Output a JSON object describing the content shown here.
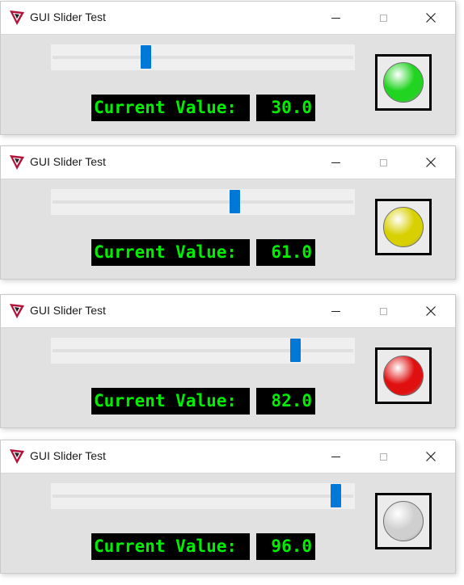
{
  "colors": {
    "lcd_text": "#00ee00",
    "lcd_background": "#000000",
    "slider_thumb": "#0078d7",
    "lamp_green": "#22d422",
    "lamp_yellow": "#d8d000",
    "lamp_red": "#e01010",
    "lamp_gray": "#cfcfcf"
  },
  "windows": [
    {
      "title": "GUI Slider Test",
      "slider_value": 30.0,
      "value_label": "Current Value:",
      "value_text": "30.0",
      "lamp_color": "green",
      "lamp_hex": "#22d422"
    },
    {
      "title": "GUI Slider Test",
      "slider_value": 61.0,
      "value_label": "Current Value:",
      "value_text": "61.0",
      "lamp_color": "yellow",
      "lamp_hex": "#d8d000"
    },
    {
      "title": "GUI Slider Test",
      "slider_value": 82.0,
      "value_label": "Current Value:",
      "value_text": "82.0",
      "lamp_color": "red",
      "lamp_hex": "#e01010"
    },
    {
      "title": "GUI Slider Test",
      "slider_value": 96.0,
      "value_label": "Current Value:",
      "value_text": "96.0",
      "lamp_color": "gray",
      "lamp_hex": "#cfcfcf"
    }
  ],
  "icons": {
    "app": "app-logo-icon",
    "minimize": "minimize-icon",
    "maximize": "maximize-icon",
    "close": "close-icon"
  }
}
